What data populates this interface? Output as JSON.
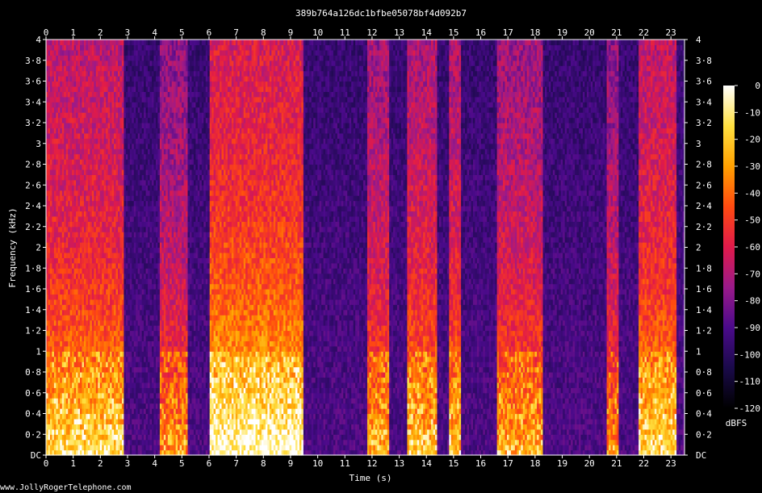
{
  "chart_data": {
    "type": "heatmap",
    "title": "389b764a126dc1bfbe05078bf4d092b7",
    "xlabel": "Time (s)",
    "ylabel": "Frequency (kHz)",
    "xlim": [
      0,
      23.5
    ],
    "ylim": [
      0,
      4
    ],
    "x_ticks": [
      "0",
      "1",
      "2",
      "3",
      "4",
      "5",
      "6",
      "7",
      "8",
      "9",
      "10",
      "11",
      "12",
      "13",
      "14",
      "15",
      "16",
      "17",
      "18",
      "19",
      "20",
      "21",
      "22",
      "23"
    ],
    "y_ticks": [
      {
        "value": 0,
        "label": "DC"
      },
      {
        "value": 0.2,
        "label": "0·2"
      },
      {
        "value": 0.4,
        "label": "0·4"
      },
      {
        "value": 0.6,
        "label": "0·6"
      },
      {
        "value": 0.8,
        "label": "0·8"
      },
      {
        "value": 1.0,
        "label": "1"
      },
      {
        "value": 1.2,
        "label": "1·2"
      },
      {
        "value": 1.4,
        "label": "1·4"
      },
      {
        "value": 1.6,
        "label": "1·6"
      },
      {
        "value": 1.8,
        "label": "1·8"
      },
      {
        "value": 2.0,
        "label": "2"
      },
      {
        "value": 2.2,
        "label": "2·2"
      },
      {
        "value": 2.4,
        "label": "2·4"
      },
      {
        "value": 2.6,
        "label": "2·6"
      },
      {
        "value": 2.8,
        "label": "2·8"
      },
      {
        "value": 3.0,
        "label": "3"
      },
      {
        "value": 3.2,
        "label": "3·2"
      },
      {
        "value": 3.4,
        "label": "3·4"
      },
      {
        "value": 3.6,
        "label": "3·6"
      },
      {
        "value": 3.8,
        "label": "3·8"
      },
      {
        "value": 4.0,
        "label": "4"
      }
    ],
    "colorbar": {
      "unit": "dBFS",
      "ticks": [
        "0",
        "-10",
        "-20",
        "-30",
        "-40",
        "-50",
        "-60",
        "-70",
        "-80",
        "-90",
        "-100",
        "-110",
        "-120"
      ],
      "range": [
        -120,
        0
      ],
      "colors": [
        "#000000",
        "#1a0a4a",
        "#4a0a8a",
        "#9a1a8a",
        "#e01a4a",
        "#ff4a10",
        "#ffa000",
        "#ffe040",
        "#ffffff"
      ]
    },
    "speech_segments": [
      {
        "start": 0.0,
        "end": 2.9,
        "level": 0.85
      },
      {
        "start": 4.2,
        "end": 5.2,
        "level": 0.7
      },
      {
        "start": 6.0,
        "end": 9.5,
        "level": 0.95
      },
      {
        "start": 11.8,
        "end": 12.6,
        "level": 0.75
      },
      {
        "start": 13.3,
        "end": 14.4,
        "level": 0.8
      },
      {
        "start": 14.8,
        "end": 15.3,
        "level": 0.8
      },
      {
        "start": 16.6,
        "end": 18.3,
        "level": 0.75
      },
      {
        "start": 20.6,
        "end": 21.1,
        "level": 0.7
      },
      {
        "start": 21.8,
        "end": 23.2,
        "level": 0.85
      }
    ],
    "background_level": 0.25
  },
  "footer": {
    "credit": "www.JollyRogerTelephone.com"
  }
}
